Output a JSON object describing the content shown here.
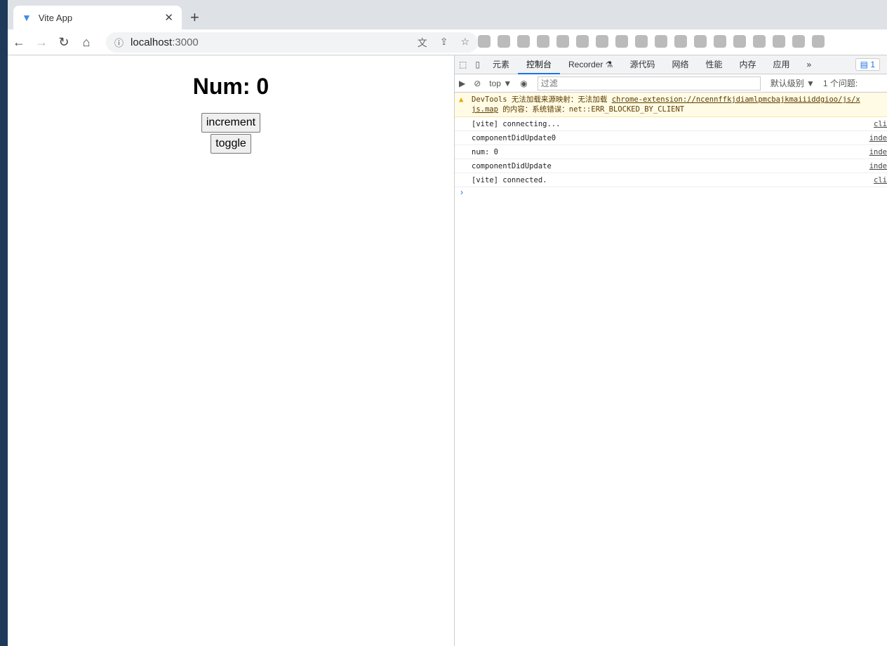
{
  "browser": {
    "tab_title": "Vite App",
    "url_host": "localhost",
    "url_port": ":3000"
  },
  "page": {
    "heading": "Num: 0",
    "buttons": [
      "increment",
      "toggle"
    ]
  },
  "devtools": {
    "tabs": [
      "元素",
      "控制台",
      "Recorder ⚗",
      "源代码",
      "网络",
      "性能",
      "内存",
      "应用"
    ],
    "more": "»",
    "issues_badge": "1",
    "context": "top ▼",
    "filter_placeholder": "过滤",
    "level": "默认级别 ▼",
    "issues": "1 个问题:",
    "warning": {
      "line1": "DevTools 无法加载来源映射：无法加载 ",
      "link": "chrome-extension://ncennffkjdiamlpmcbajkmaiiiddgioo/js/x",
      "link2": "js.map",
      "line2": " 的内容：系统错误：net::ERR_BLOCKED_BY_CLIENT"
    },
    "logs": [
      {
        "msg": "[vite] connecting...",
        "src": "cli"
      },
      {
        "msg": "componentDidUpdate0",
        "src": "inde"
      },
      {
        "msg": "num: 0",
        "src": "inde"
      },
      {
        "msg": "componentDidUpdate",
        "src": "inde"
      },
      {
        "msg": "[vite] connected.",
        "src": "cli"
      }
    ],
    "prompt": "›"
  }
}
